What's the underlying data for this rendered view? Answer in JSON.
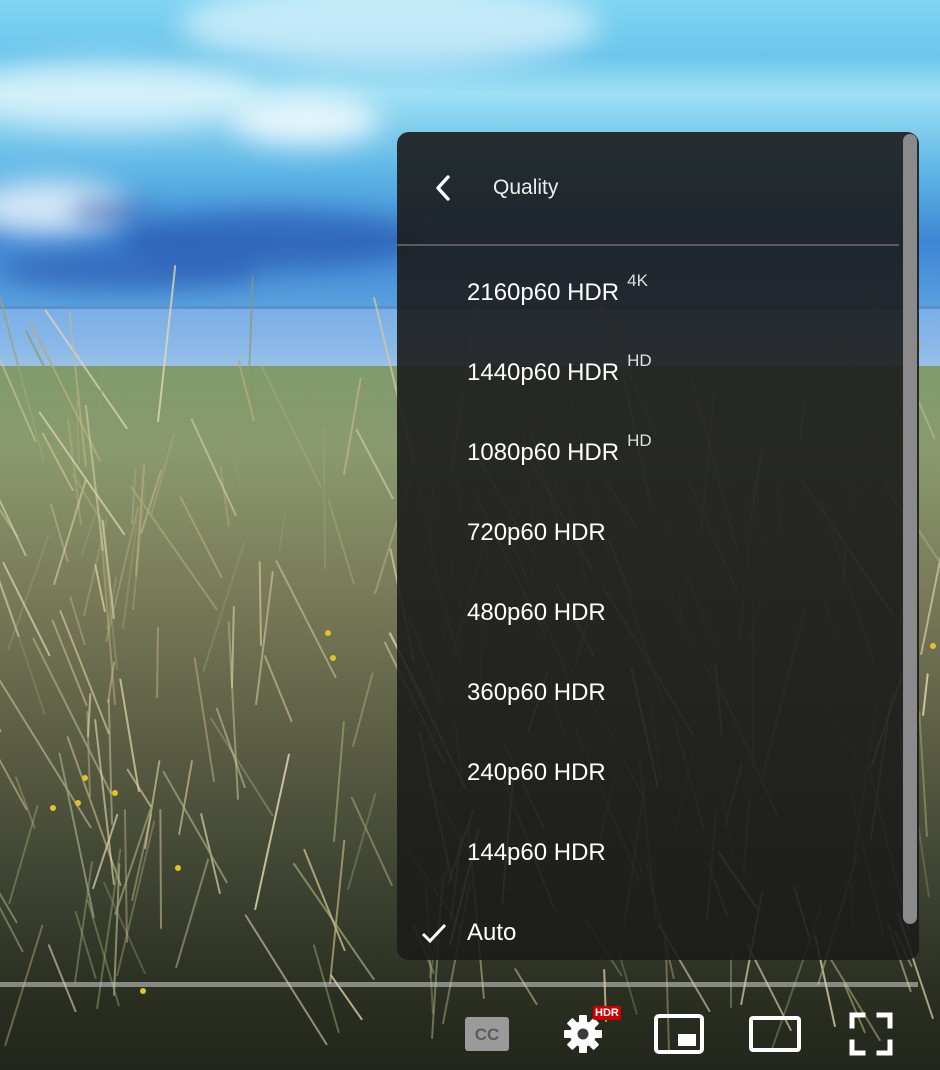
{
  "panel": {
    "title": "Quality",
    "back_icon": "chevron-left-icon",
    "items": [
      {
        "label": "2160p60 HDR",
        "badge": "4K",
        "selected": false
      },
      {
        "label": "1440p60 HDR",
        "badge": "HD",
        "selected": false
      },
      {
        "label": "1080p60 HDR",
        "badge": "HD",
        "selected": false
      },
      {
        "label": "720p60 HDR",
        "badge": "",
        "selected": false
      },
      {
        "label": "480p60 HDR",
        "badge": "",
        "selected": false
      },
      {
        "label": "360p60 HDR",
        "badge": "",
        "selected": false
      },
      {
        "label": "240p60 HDR",
        "badge": "",
        "selected": false
      },
      {
        "label": "144p60 HDR",
        "badge": "",
        "selected": false
      },
      {
        "label": "Auto",
        "badge": "",
        "selected": true
      }
    ]
  },
  "controls": {
    "captions_label": "CC",
    "settings_badge": "HDR",
    "icons": [
      "captions-icon",
      "settings-gear-icon",
      "miniplayer-icon",
      "theater-mode-icon",
      "fullscreen-icon"
    ]
  },
  "colors": {
    "panel_bg": "#1c1c1c",
    "hdr_badge": "#d00000",
    "text": "#ffffff"
  }
}
